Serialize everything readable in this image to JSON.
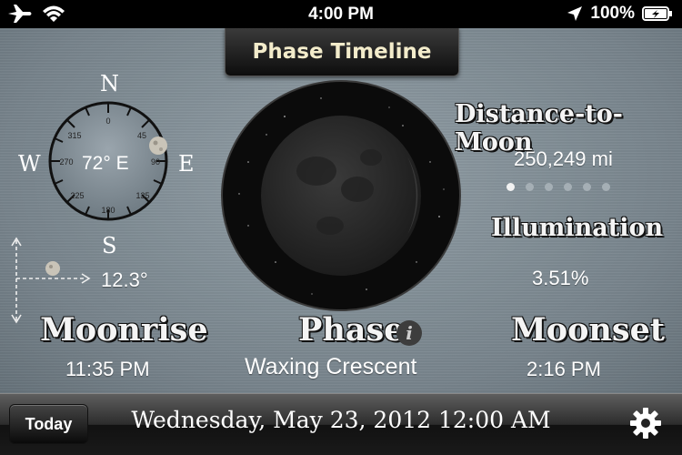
{
  "status_bar": {
    "time": "4:00 PM",
    "battery_percent": "100%",
    "icons": [
      "airplane-icon",
      "wifi-icon",
      "location-arrow-icon",
      "battery-charging-icon"
    ]
  },
  "header": {
    "phase_timeline_label": "Phase Timeline"
  },
  "compass": {
    "letters": {
      "n": "N",
      "e": "E",
      "s": "S",
      "w": "W"
    },
    "ticks": [
      "0",
      "45",
      "90",
      "135",
      "180",
      "225",
      "270",
      "315"
    ],
    "azimuth": "72° E",
    "altitude": "12.3°"
  },
  "distance": {
    "label": "Distance-to-Moon",
    "value": "250,249 mi"
  },
  "illumination": {
    "label": "Illumination",
    "value": "3.51%"
  },
  "page_dots": {
    "count": 6,
    "active_index": 0
  },
  "moonrise": {
    "label": "Moonrise",
    "time": "11:35 PM"
  },
  "phase": {
    "label": "Phase",
    "value": "Waxing Crescent"
  },
  "moonset": {
    "label": "Moonset",
    "time": "2:16 PM"
  },
  "toolbar": {
    "today_label": "Today",
    "datetime": "Wednesday, May 23, 2012 12:00 AM"
  },
  "colors": {
    "accent_title": "#f3eccb",
    "background": "#7d8a93",
    "toolbar": "#1a1a1a"
  }
}
